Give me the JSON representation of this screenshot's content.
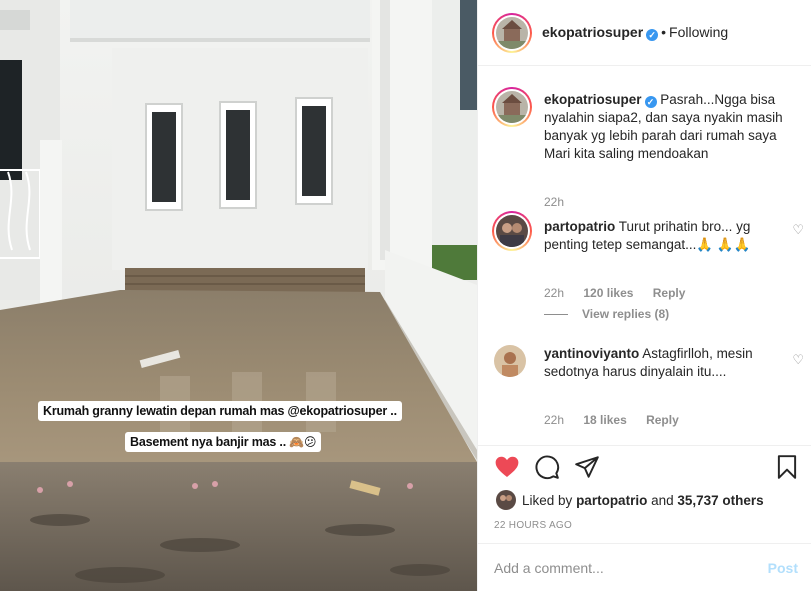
{
  "post": {
    "username": "ekopatriosuper",
    "follow_status": "Following",
    "separator": "•",
    "caption_1": "Krumah granny  lewatin depan rumah mas @ekopatriosuper ..",
    "caption_2": "Basement nya banjir mas .. ",
    "caption_2_emoji": "🙈😕"
  },
  "comments": [
    {
      "username": "ekopatriosuper",
      "text": "Pasrah...Ngga bisa nyalahin siapa2, dan saya nyakin masih banyak yg lebih parah dari rumah saya Mari kita saling mendoakan",
      "time": "22h"
    },
    {
      "username": "partopatrio",
      "text": "Turut prihatin bro... yg penting tetep semangat...🙏 🙏🙏",
      "time": "22h",
      "likes": "120 likes",
      "reply": "Reply",
      "view_replies": "View replies (8)"
    },
    {
      "username": "yantinoviyanto",
      "text": "Astagfirlloh, mesin sedotnya harus dinyalain itu....",
      "time": "22h",
      "likes": "18 likes",
      "reply": "Reply"
    }
  ],
  "likes": {
    "prefix": "Liked by",
    "user": "partopatrio",
    "and": "and",
    "others": "35,737 others"
  },
  "timestamp": "22 HOURS AGO",
  "add_comment": {
    "placeholder": "Add a comment...",
    "post_label": "Post"
  },
  "icons": {
    "like": "heart-icon",
    "comment": "comment-icon",
    "share": "share-icon",
    "save": "bookmark-icon",
    "like_color": "#ed4956"
  }
}
